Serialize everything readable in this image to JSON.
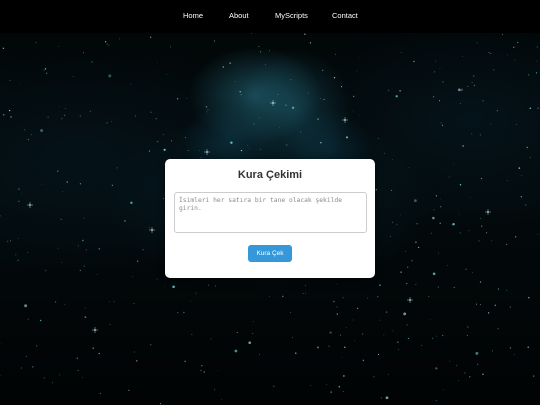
{
  "nav": {
    "items": [
      {
        "label": "Home"
      },
      {
        "label": "About"
      },
      {
        "label": "MyScripts"
      },
      {
        "label": "Contact"
      }
    ]
  },
  "card": {
    "title": "Kura Çekimi",
    "textarea": {
      "value": "",
      "placeholder": "İsimleri her satıra bir tane olacak şekilde girin."
    },
    "button_label": "Kura Çek"
  },
  "colors": {
    "nav_bg": "#000000",
    "accent": "#3498db",
    "card_bg": "#ffffff",
    "title_text": "#333333"
  },
  "background": {
    "description_icon": "space-nebula-background"
  }
}
